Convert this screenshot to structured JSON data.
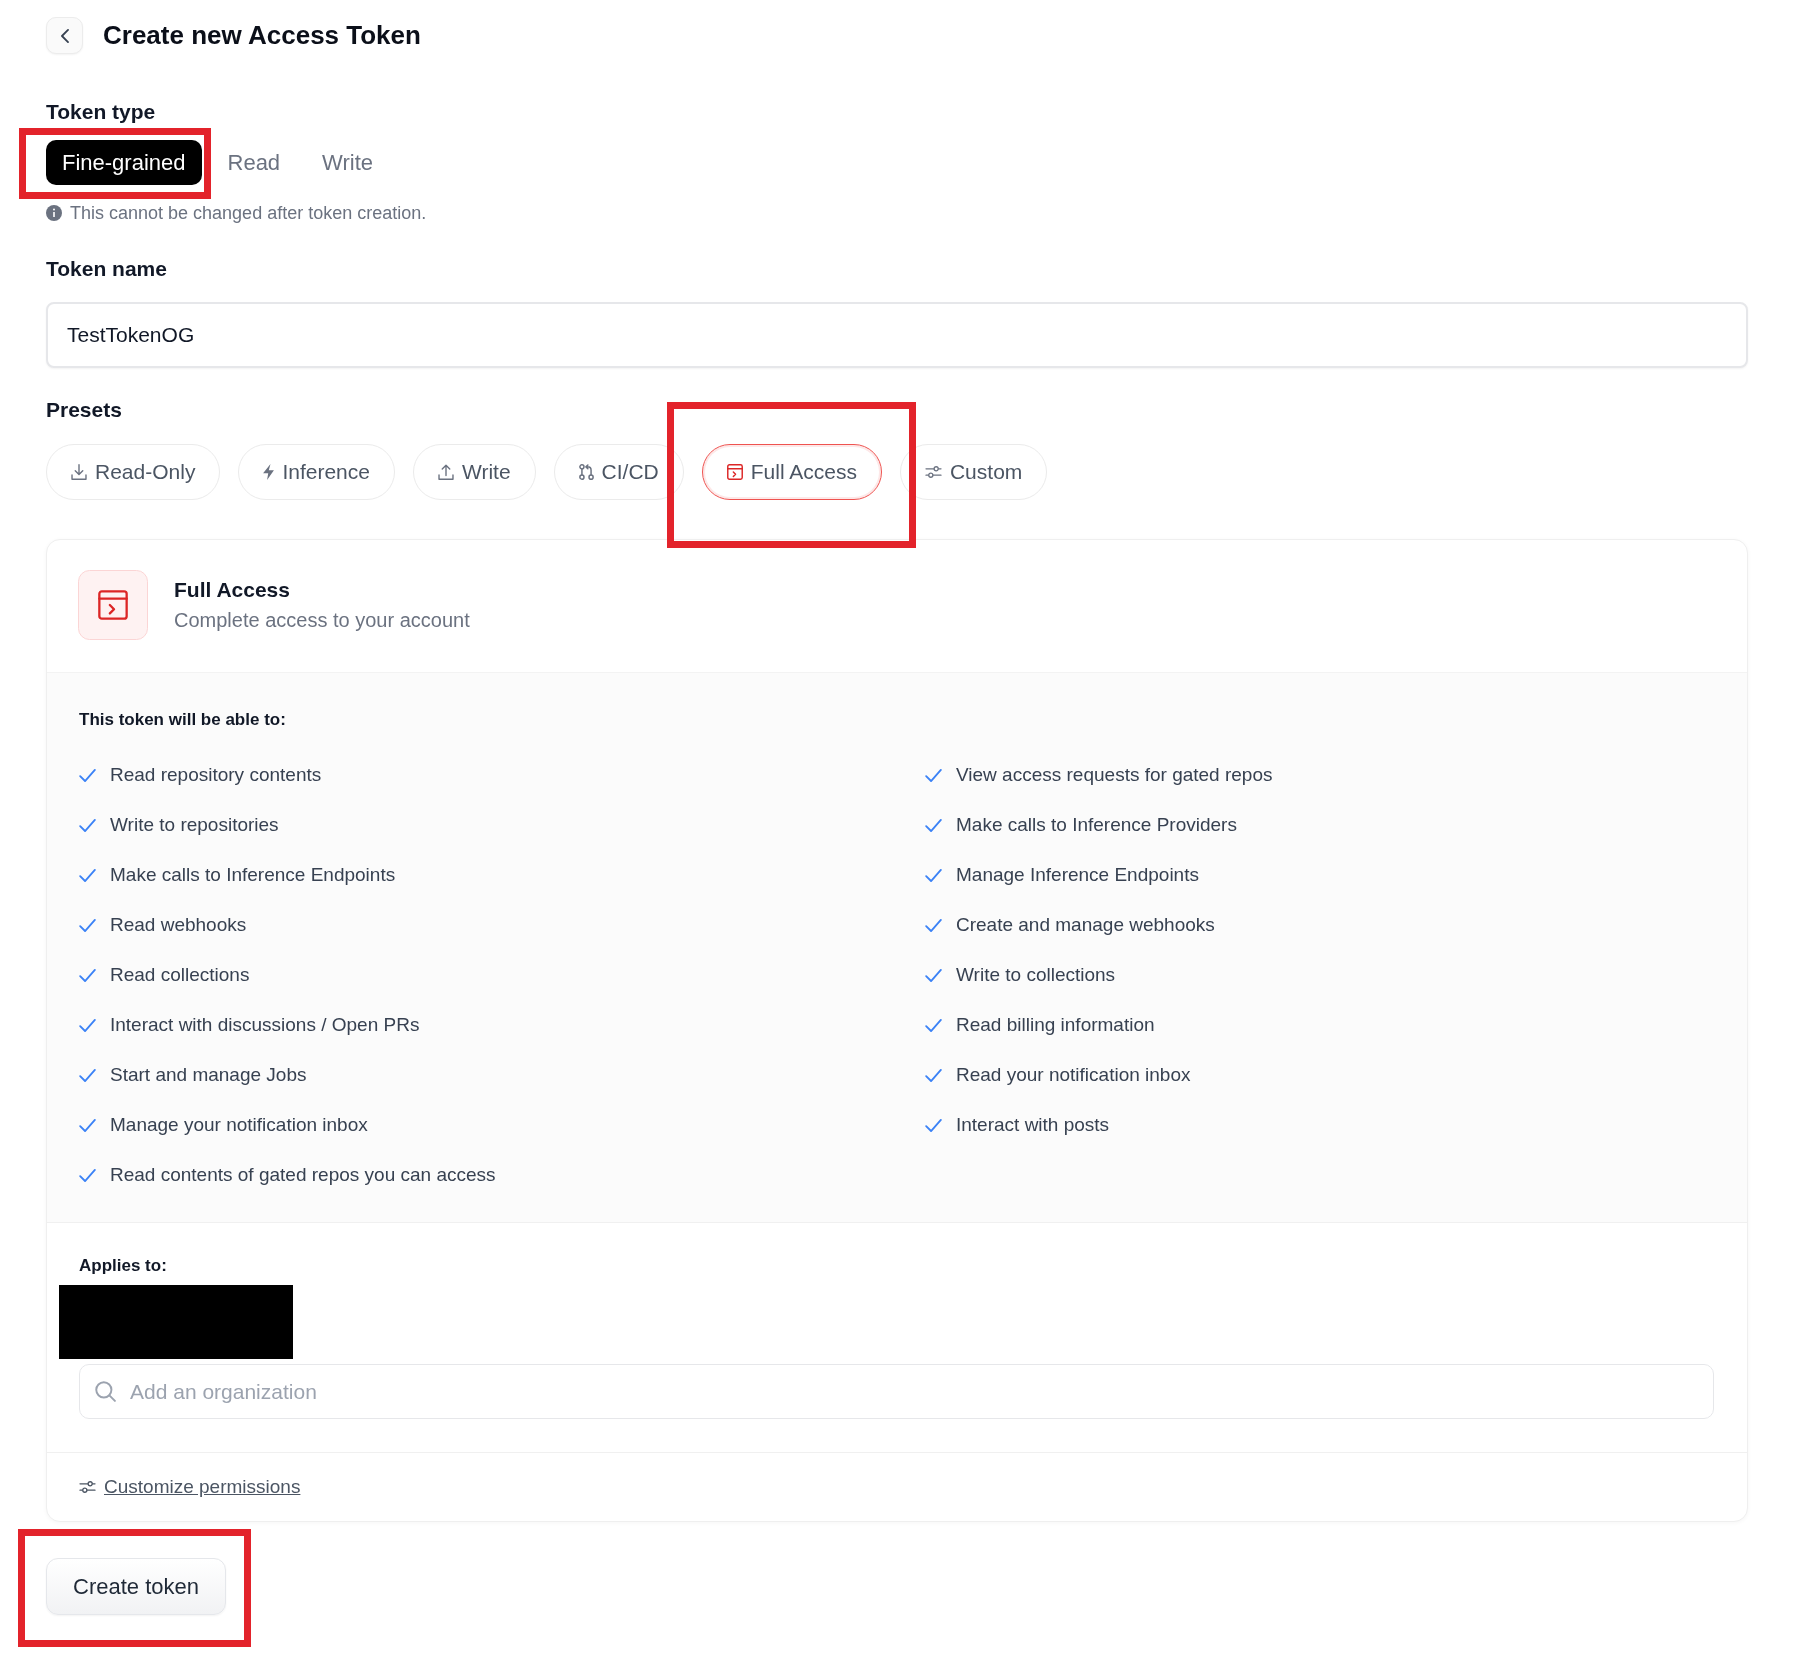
{
  "header": {
    "title": "Create new Access Token"
  },
  "token_type": {
    "label": "Token type",
    "options": [
      {
        "label": "Fine-grained",
        "selected": true,
        "highlighted": true
      },
      {
        "label": "Read",
        "selected": false,
        "highlighted": false
      },
      {
        "label": "Write",
        "selected": false,
        "highlighted": false
      }
    ],
    "note": "This cannot be changed after token creation."
  },
  "token_name": {
    "label": "Token name",
    "value": "TestTokenOG"
  },
  "presets": {
    "label": "Presets",
    "items": [
      {
        "label": "Read-Only",
        "selected": false,
        "highlighted": false
      },
      {
        "label": "Inference",
        "selected": false,
        "highlighted": false
      },
      {
        "label": "Write",
        "selected": false,
        "highlighted": false
      },
      {
        "label": "CI/CD",
        "selected": false,
        "highlighted": false
      },
      {
        "label": "Full Access",
        "selected": true,
        "highlighted": true
      },
      {
        "label": "Custom",
        "selected": false,
        "highlighted": false
      }
    ]
  },
  "preset_card": {
    "title": "Full Access",
    "description": "Complete access to your account",
    "capabilities_heading": "This token will be able to:",
    "capabilities": [
      "Read repository contents",
      "View access requests for gated repos",
      "Write to repositories",
      "Make calls to Inference Providers",
      "Make calls to Inference Endpoints",
      "Manage Inference Endpoints",
      "Read webhooks",
      "Create and manage webhooks",
      "Read collections",
      "Write to collections",
      "Interact with discussions / Open PRs",
      "Read billing information",
      "Start and manage Jobs",
      "Read your notification inbox",
      "Manage your notification inbox",
      "Interact with posts",
      "Read contents of gated repos you can access"
    ],
    "applies_to": {
      "label": "Applies to:",
      "redacted": true,
      "search": {
        "placeholder": "Add an organization"
      }
    },
    "customize_link": "Customize permissions"
  },
  "create_button": {
    "label": "Create token",
    "highlighted": true
  }
}
